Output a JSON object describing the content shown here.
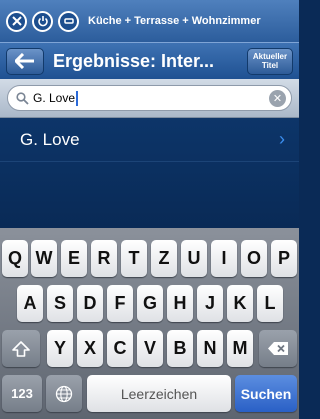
{
  "zonebar": {
    "icons": [
      "close-icon",
      "power-icon",
      "minus-icon"
    ],
    "zone_label": "Küche + Terrasse + Wohnzimmer"
  },
  "navbar": {
    "title": "Ergebnisse: Inter...",
    "nowplaying_line1": "Aktueller",
    "nowplaying_line2": "Titel"
  },
  "search": {
    "query": "G. Love"
  },
  "results": [
    {
      "label": "G. Love"
    }
  ],
  "keyboard": {
    "row1": [
      "Q",
      "W",
      "E",
      "R",
      "T",
      "Z",
      "U",
      "I",
      "O",
      "P"
    ],
    "row2": [
      "A",
      "S",
      "D",
      "F",
      "G",
      "H",
      "J",
      "K",
      "L"
    ],
    "row3": [
      "Y",
      "X",
      "C",
      "V",
      "B",
      "N",
      "M"
    ],
    "numbers_label": "123",
    "space_label": "Leerzeichen",
    "search_label": "Suchen"
  },
  "colors": {
    "accent": "#2a60c6",
    "background": "#0a2a56"
  }
}
